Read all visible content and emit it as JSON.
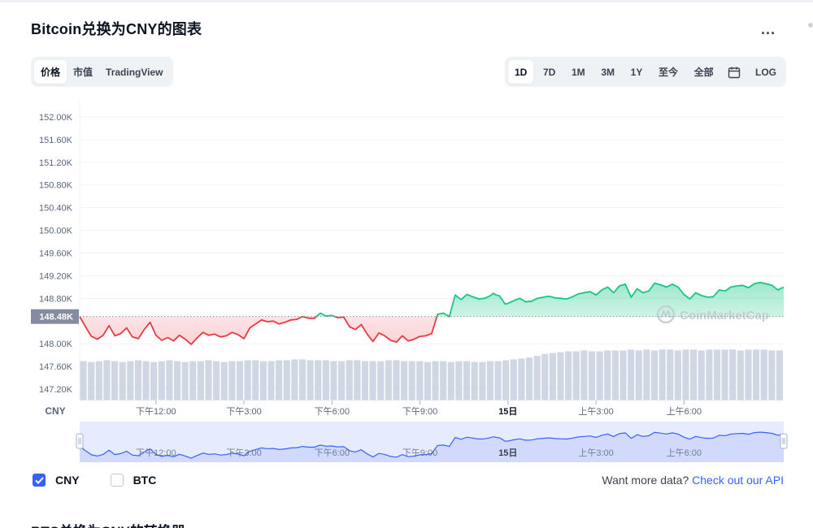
{
  "header": {
    "title": "Bitcoin兑换为CNY的图表",
    "more_label": "..."
  },
  "tabs_left": [
    {
      "label": "价格",
      "active": true
    },
    {
      "label": "市值",
      "active": false
    },
    {
      "label": "TradingView",
      "active": false
    }
  ],
  "tabs_right": [
    {
      "label": "1D",
      "active": true
    },
    {
      "label": "7D",
      "active": false
    },
    {
      "label": "1M",
      "active": false
    },
    {
      "label": "3M",
      "active": false
    },
    {
      "label": "1Y",
      "active": false
    },
    {
      "label": "至今",
      "active": false
    },
    {
      "label": "全部",
      "active": false
    }
  ],
  "calendar_icon": "calendar-icon",
  "log_label": "LOG",
  "currency_toggles": [
    {
      "label": "CNY",
      "checked": true
    },
    {
      "label": "BTC",
      "checked": false
    }
  ],
  "api": {
    "prefix": "Want more data?",
    "link": "Check out our API"
  },
  "section_title": "BTC兑换为CNY的转换器",
  "watermark": "CoinMarketCap",
  "colors": {
    "up": "#16c784",
    "down": "#ea3943",
    "accent": "#3861fb",
    "volume": "#cfd6e4"
  },
  "chart_data": {
    "type": "line",
    "ylim": [
      147000,
      152200
    ],
    "yticks": [
      "152.00K",
      "151.60K",
      "151.20K",
      "150.80K",
      "150.40K",
      "150.00K",
      "149.60K",
      "149.20K",
      "148.80K",
      "148.48K",
      "148.00K",
      "147.60K",
      "147.20K"
    ],
    "ytick_values": [
      152000,
      151600,
      151200,
      150800,
      150400,
      150000,
      149600,
      149200,
      148800,
      148480,
      148000,
      147600,
      147200
    ],
    "baseline": 148480,
    "baseline_label": "148.48K",
    "y_unit_label": "CNY",
    "xlim": [
      0,
      24
    ],
    "xticks": [
      {
        "label": "下午12:00",
        "x": 2.6
      },
      {
        "label": "下午3:00",
        "x": 5.6
      },
      {
        "label": "下午6:00",
        "x": 8.6
      },
      {
        "label": "下午9:00",
        "x": 11.6
      },
      {
        "label": "15日",
        "x": 14.6
      },
      {
        "label": "上午3:00",
        "x": 17.6
      },
      {
        "label": "上午6:00",
        "x": 20.6
      }
    ],
    "series": [
      {
        "x": [
          0,
          0.2,
          0.4,
          0.6,
          0.8,
          1.0,
          1.2,
          1.4,
          1.6,
          1.8,
          2.0,
          2.2,
          2.4,
          2.6,
          2.8,
          3.0,
          3.2,
          3.4,
          3.6,
          3.8,
          4.0,
          4.2,
          4.4,
          4.6,
          4.8,
          5.0,
          5.2,
          5.4,
          5.6,
          5.8,
          6.0,
          6.2,
          6.4,
          6.6,
          6.8,
          7.0,
          7.2,
          7.4,
          7.6,
          7.8,
          8.0,
          8.2,
          8.4,
          8.6,
          8.8,
          9.0,
          9.2,
          9.4,
          9.6,
          9.8,
          10.0,
          10.2,
          10.4,
          10.6,
          10.8,
          11.0,
          11.2,
          11.4,
          11.6,
          11.8,
          12.0,
          12.2,
          12.4,
          12.6,
          12.8,
          13.0,
          13.2,
          13.4,
          13.6,
          13.8,
          14.0,
          14.1,
          14.2,
          14.3,
          14.4,
          14.5,
          14.6,
          14.8,
          15.0,
          15.2,
          15.4,
          15.6,
          15.8,
          16.0,
          16.2,
          16.4,
          16.6,
          16.8,
          17.0,
          17.2,
          17.4,
          17.6,
          17.8,
          18.0,
          18.2,
          18.4,
          18.6,
          18.8,
          19.0,
          19.2,
          19.4,
          19.6,
          19.8,
          20.0,
          20.2,
          20.4,
          20.6,
          20.8,
          21.0,
          21.2,
          21.4,
          21.6,
          21.8,
          22.0,
          22.2,
          22.4,
          22.6,
          22.8,
          23.0,
          23.2,
          23.4,
          23.6,
          23.8,
          24.0
        ],
        "y": [
          148480,
          148300,
          148130,
          148080,
          148150,
          148320,
          148140,
          148180,
          148280,
          148120,
          148090,
          148250,
          148380,
          148150,
          148060,
          148110,
          148050,
          148150,
          148080,
          147990,
          148100,
          148200,
          148150,
          148170,
          148120,
          148140,
          148200,
          148160,
          148090,
          148280,
          148350,
          148420,
          148390,
          148400,
          148350,
          148380,
          148420,
          148430,
          148480,
          148450,
          148450,
          148540,
          148490,
          148500,
          148460,
          148470,
          148300,
          148250,
          148340,
          148170,
          148040,
          148190,
          148140,
          148060,
          148030,
          148140,
          148050,
          148080,
          148130,
          148140,
          148180,
          148520,
          148540,
          148480,
          148860,
          148780,
          148870,
          148830,
          148790,
          148800,
          148850,
          148890,
          148860,
          148850,
          148780,
          148700,
          148710,
          148760,
          148800,
          148740,
          148750,
          148800,
          148820,
          148840,
          148810,
          148800,
          148790,
          148830,
          148880,
          148900,
          148920,
          148860,
          148950,
          149000,
          148900,
          149020,
          149050,
          148820,
          148970,
          148900,
          148930,
          149070,
          149040,
          149000,
          149050,
          149000,
          148870,
          148790,
          148900,
          148850,
          148820,
          148830,
          148950,
          148930,
          149000,
          149020,
          149030,
          148990,
          149060,
          149080,
          149060,
          149030,
          148950,
          149000
        ]
      }
    ],
    "volume": [
      0.44,
      0.43,
      0.44,
      0.45,
      0.44,
      0.43,
      0.44,
      0.45,
      0.44,
      0.43,
      0.44,
      0.45,
      0.44,
      0.43,
      0.44,
      0.44,
      0.45,
      0.44,
      0.43,
      0.44,
      0.44,
      0.45,
      0.45,
      0.44,
      0.44,
      0.45,
      0.45,
      0.46,
      0.46,
      0.45,
      0.45,
      0.45,
      0.44,
      0.44,
      0.45,
      0.45,
      0.44,
      0.44,
      0.44,
      0.45,
      0.45,
      0.44,
      0.44,
      0.44,
      0.43,
      0.44,
      0.44,
      0.43,
      0.44,
      0.44,
      0.43,
      0.43,
      0.44,
      0.44,
      0.45,
      0.46,
      0.47,
      0.48,
      0.5,
      0.52,
      0.53,
      0.54,
      0.55,
      0.55,
      0.56,
      0.55,
      0.55,
      0.56,
      0.56,
      0.56,
      0.57,
      0.56,
      0.57,
      0.56,
      0.57,
      0.57,
      0.56,
      0.57,
      0.57,
      0.56,
      0.57,
      0.57,
      0.57,
      0.57,
      0.56,
      0.57,
      0.57,
      0.57,
      0.56,
      0.56
    ]
  },
  "navigator": {
    "xticks": [
      "下午12:00",
      "下午3:00",
      "下午6:00",
      "下午9:00",
      "15日",
      "上午3:00",
      "上午6:00"
    ]
  }
}
